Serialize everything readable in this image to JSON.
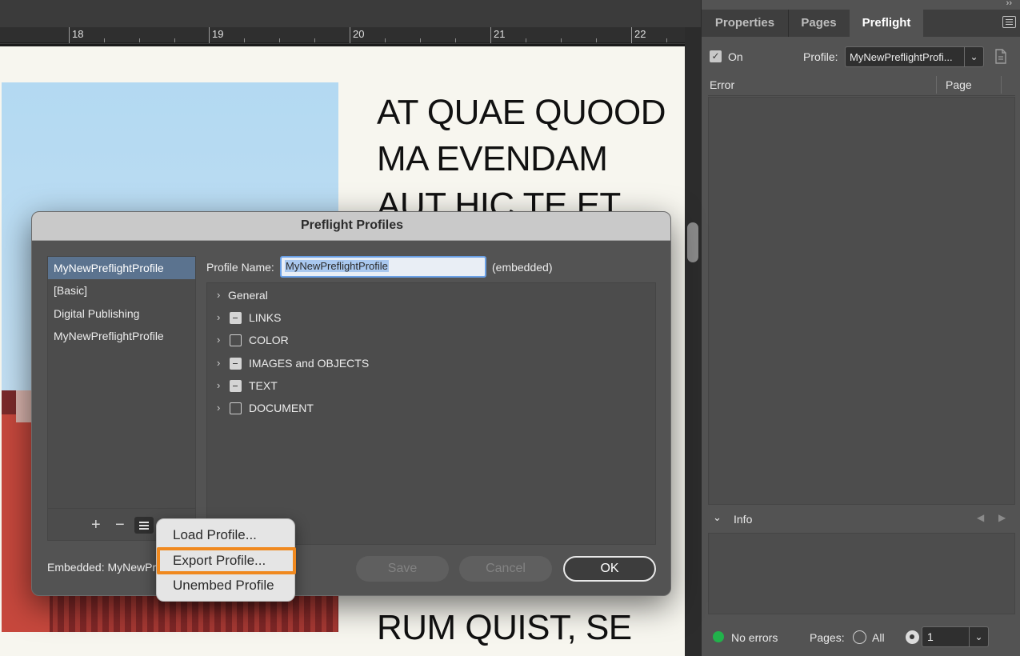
{
  "canvas": {
    "ruler_labels": [
      "18",
      "19",
      "20",
      "21",
      "22"
    ],
    "text_lines": [
      "AT QUAE QUOOD",
      "MA EVENDAM",
      "AUT HIC TE ET"
    ],
    "bottom_text": "RUM QUIST, SE"
  },
  "panel": {
    "collapse_glyph": "››",
    "tabs": [
      {
        "label": "Properties",
        "active": false
      },
      {
        "label": "Pages",
        "active": false
      },
      {
        "label": "Preflight",
        "active": true
      }
    ],
    "on_label": "On",
    "on_checked": true,
    "profile_label": "Profile:",
    "profile_value": "MyNewPreflightProfi...",
    "error_header": "Error",
    "page_header": "Page",
    "info_label": "Info",
    "status_text": "No errors",
    "pages_label": "Pages:",
    "all_label": "All",
    "page_value": "1",
    "status_color": "#21b24b"
  },
  "dialog": {
    "title": "Preflight Profiles",
    "profiles": [
      "MyNewPreflightProfile",
      "[Basic]",
      "Digital Publishing",
      "MyNewPreflightProfile"
    ],
    "selected_index": 0,
    "add_label": "+",
    "remove_label": "−",
    "profile_name_label": "Profile Name:",
    "profile_name_value": "MyNewPreflightProfile",
    "embedded_tag": "(embedded)",
    "tree": [
      {
        "label": "General",
        "checkbox": "none"
      },
      {
        "label": "LINKS",
        "checkbox": "mixed"
      },
      {
        "label": "COLOR",
        "checkbox": "empty"
      },
      {
        "label": "IMAGES and OBJECTS",
        "checkbox": "mixed"
      },
      {
        "label": "TEXT",
        "checkbox": "mixed"
      },
      {
        "label": "DOCUMENT",
        "checkbox": "empty"
      }
    ],
    "embedded_label": "Embedded: MyNewPre",
    "save_label": "Save",
    "cancel_label": "Cancel",
    "ok_label": "OK"
  },
  "popup_menu": {
    "items": [
      "Load Profile...",
      "Export Profile...",
      "Unembed Profile"
    ],
    "highlighted_index": 1,
    "highlight_color": "#f0891f"
  }
}
